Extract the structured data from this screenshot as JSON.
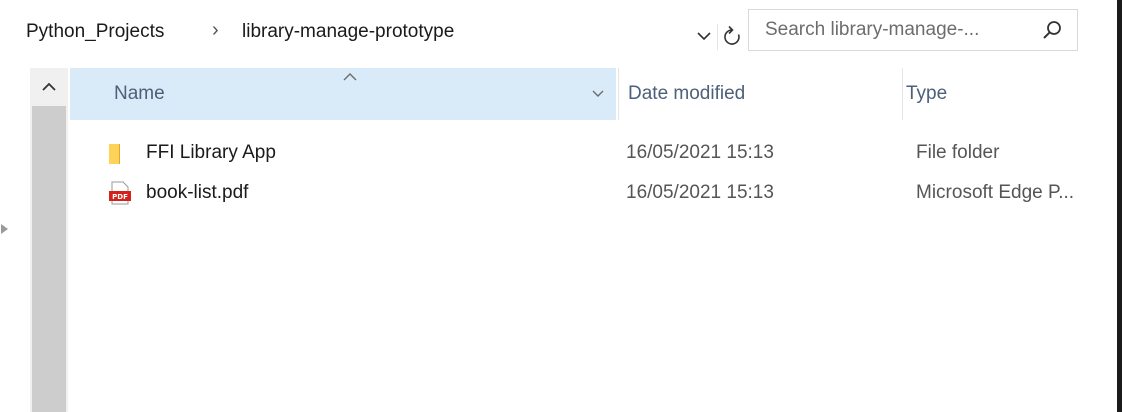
{
  "address_bar": {
    "breadcrumbs": [
      "Python_Projects",
      "library-manage-prototype"
    ],
    "separator": "›"
  },
  "search": {
    "placeholder": "Search library-manage-..."
  },
  "file_list": {
    "columns": {
      "name": "Name",
      "date_modified": "Date modified",
      "type": "Type"
    },
    "sorted_column": "Name",
    "rows": [
      {
        "name": "FFI Library App",
        "date_modified": "16/05/2021 15:13",
        "type": "File folder",
        "icon": "folder-icon"
      },
      {
        "name": "book-list.pdf",
        "date_modified": "16/05/2021 15:13",
        "type": "Microsoft Edge P...",
        "icon": "pdf-icon"
      }
    ]
  },
  "colors": {
    "header_selected_bg": "#d9ebf9",
    "folder_yellow": "#ffd357",
    "pdf_red": "#d2221a",
    "header_text": "#4c607a"
  }
}
